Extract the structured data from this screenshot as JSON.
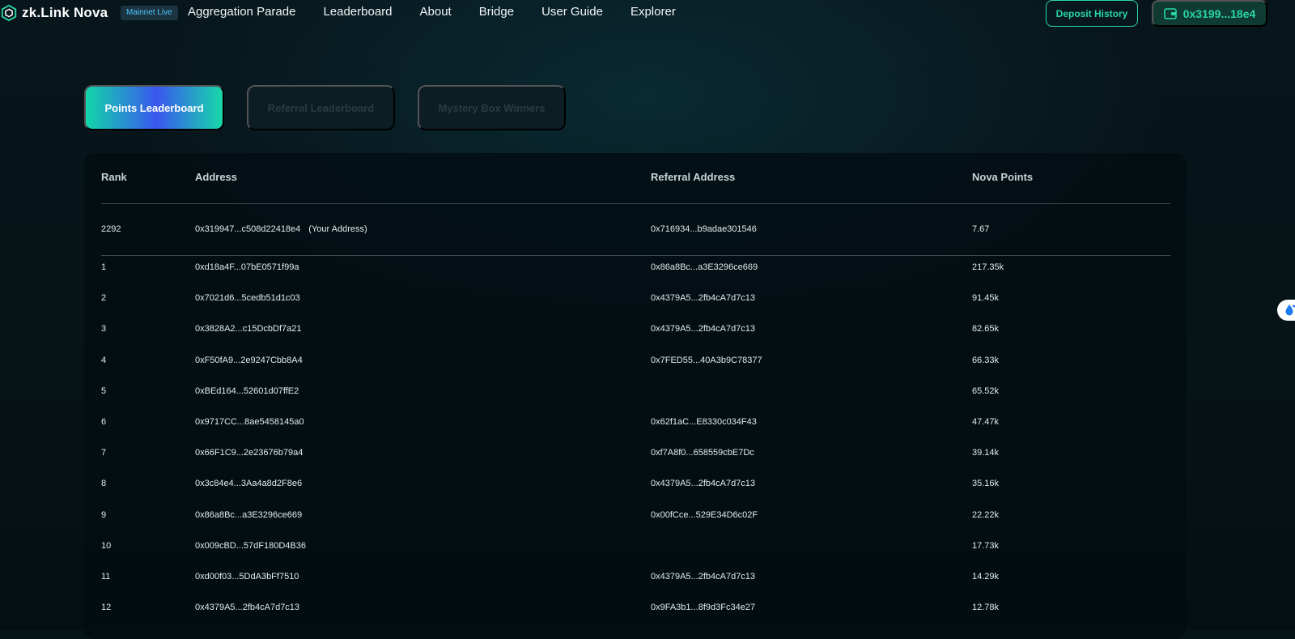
{
  "header": {
    "logo_text": "zk.Link Nova",
    "badge": "Mainnet Live",
    "nav": [
      "Aggregation Parade",
      "Leaderboard",
      "About",
      "Bridge",
      "User Guide",
      "Explorer"
    ],
    "deposit_history": "Deposit History",
    "wallet_address": "0x3199...18e4"
  },
  "tabs": {
    "points": "Points Leaderboard",
    "referral": "Referral Leaderboard",
    "mystery": "Mystery Box Winners"
  },
  "table": {
    "headers": {
      "rank": "Rank",
      "address": "Address",
      "referral": "Referral Address",
      "points": "Nova Points"
    },
    "your_row": {
      "rank": "2292",
      "address": "0x319947...c508d22418e4",
      "tag": "(Your Address)",
      "referral": "0x716934...b9adae301546",
      "points": "7.67"
    },
    "rows": [
      {
        "rank": "1",
        "address": "0xd18a4F...07bE0571f99a",
        "referral": "0x86a8Bc...a3E3296ce669",
        "points": "217.35k"
      },
      {
        "rank": "2",
        "address": "0x7021d6...5cedb51d1c03",
        "referral": "0x4379A5...2fb4cA7d7c13",
        "points": "91.45k"
      },
      {
        "rank": "3",
        "address": "0x3828A2...c15DcbDf7a21",
        "referral": "0x4379A5...2fb4cA7d7c13",
        "points": "82.65k"
      },
      {
        "rank": "4",
        "address": "0xF50fA9...2e9247Cbb8A4",
        "referral": "0x7FED55...40A3b9C78377",
        "points": "66.33k"
      },
      {
        "rank": "5",
        "address": "0xBEd164...52601d07ffE2",
        "referral": "",
        "points": "65.52k"
      },
      {
        "rank": "6",
        "address": "0x9717CC...8ae5458145a0",
        "referral": "0x62f1aC...E8330c034F43",
        "points": "47.47k"
      },
      {
        "rank": "7",
        "address": "0x66F1C9...2e23676b79a4",
        "referral": "0xf7A8f0...658559cbE7Dc",
        "points": "39.14k"
      },
      {
        "rank": "8",
        "address": "0x3c84e4...3Aa4a8d2F8e6",
        "referral": "0x4379A5...2fb4cA7d7c13",
        "points": "35.16k"
      },
      {
        "rank": "9",
        "address": "0x86a8Bc...a3E3296ce669",
        "referral": "0x00fCce...529E34D6c02F",
        "points": "22.22k"
      },
      {
        "rank": "10",
        "address": "0x009cBD...57dF180D4B36",
        "referral": "",
        "points": "17.73k"
      },
      {
        "rank": "11",
        "address": "0xd00f03...5DdA3bFf7510",
        "referral": "0x4379A5...2fb4cA7d7c13",
        "points": "14.29k"
      },
      {
        "rank": "12",
        "address": "0x4379A5...2fb4cA7d7c13",
        "referral": "0x9FA3b1...8f9d3Fc34e27",
        "points": "12.78k"
      }
    ]
  },
  "colors": {
    "accent": "#2ad6a4",
    "background": "#061418",
    "badge_text": "#4cc7ff"
  },
  "icons": {
    "logo": "zklink-hexagon-logo-icon",
    "wallet": "wallet-icon",
    "float": "water-drop-widget-icon"
  }
}
